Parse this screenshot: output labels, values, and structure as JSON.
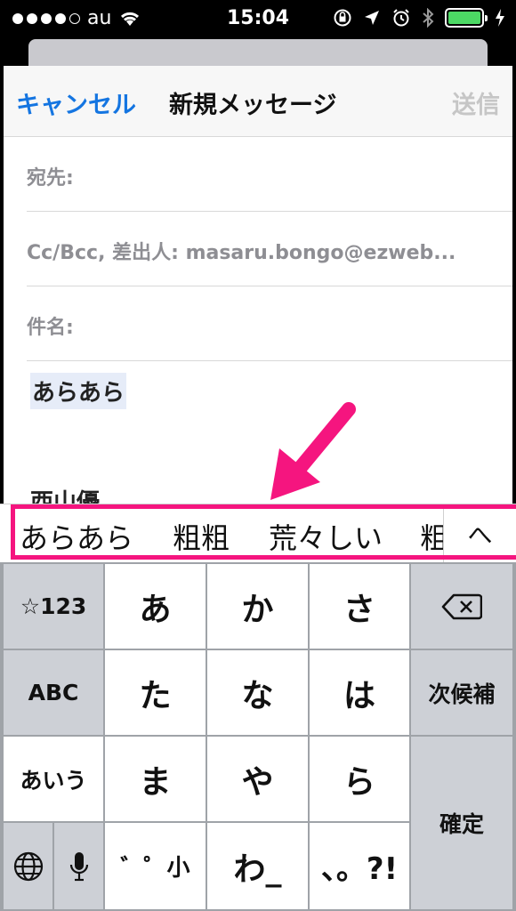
{
  "status": {
    "carrier": "au",
    "time": "15:04"
  },
  "compose": {
    "cancel": "キャンセル",
    "title": "新規メッセージ",
    "send": "送信",
    "to_label": "宛先:",
    "cc_label": "Cc/Bcc, 差出人:",
    "from_value": "masaru.bongo@ezweb...",
    "subject_label": "件名:",
    "body": "あらあら",
    "signature_partial": "西山優"
  },
  "candidates": [
    "あらあら",
    "粗粗",
    "荒々しい",
    "粗"
  ],
  "candidate_expand": "へ",
  "keyboard": {
    "num_key": "☆123",
    "abc_key": "ABC",
    "kana_key": "あいう",
    "next_candidate": "次候補",
    "confirm": "確定",
    "row1": [
      "あ",
      "か",
      "さ"
    ],
    "row2": [
      "た",
      "な",
      "は"
    ],
    "row3": [
      "ま",
      "や",
      "ら"
    ],
    "row4": [
      "゛゜小",
      "わ_",
      "、。?!"
    ]
  },
  "colors": {
    "accent_blue": "#1475e1",
    "annotation_pink": "#f5157f",
    "battery_green": "#4cd964"
  }
}
